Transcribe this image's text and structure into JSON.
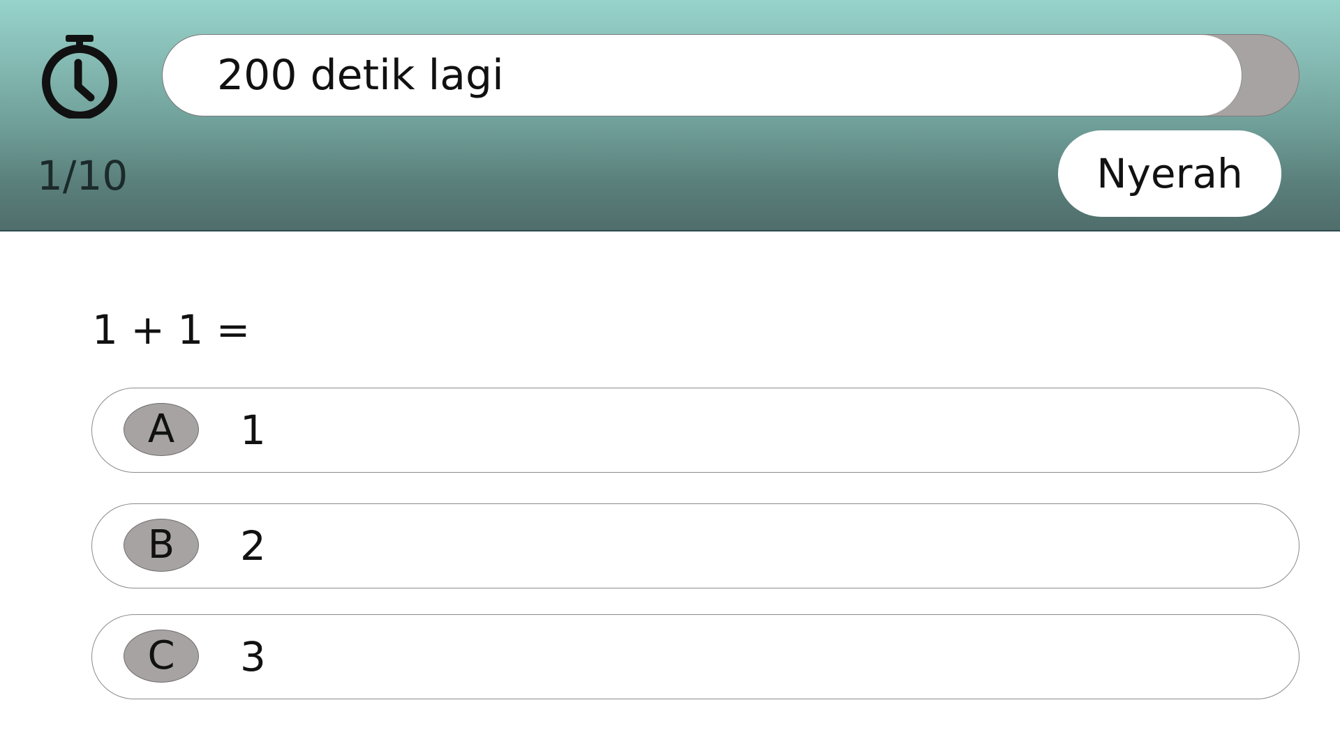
{
  "header": {
    "timer": {
      "icon": "stopwatch-icon",
      "label": "200 detik lagi",
      "remaining_fraction": 0.95
    },
    "progress": "1/10",
    "give_up_label": "Nyerah"
  },
  "question": {
    "text": "1 + 1 =",
    "options": [
      {
        "letter": "A",
        "text": "1"
      },
      {
        "letter": "B",
        "text": "2"
      },
      {
        "letter": "C",
        "text": "3"
      }
    ]
  },
  "colors": {
    "header_top": "#97d3ca",
    "header_bottom": "#506e6b",
    "badge": "#a8a3a3",
    "timer_track": "#a8a3a3"
  }
}
